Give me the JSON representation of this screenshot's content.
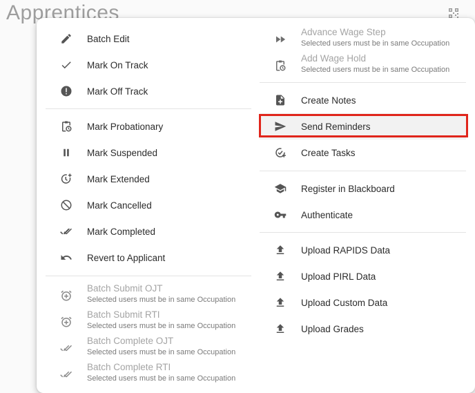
{
  "page": {
    "title": "Apprentices"
  },
  "left_menu": {
    "batch_edit": "Batch Edit",
    "mark_on_track": "Mark On Track",
    "mark_off_track": "Mark Off Track",
    "mark_probationary": "Mark Probationary",
    "mark_suspended": "Mark Suspended",
    "mark_extended": "Mark Extended",
    "mark_cancelled": "Mark Cancelled",
    "mark_completed": "Mark Completed",
    "revert_to_applicant": "Revert to Applicant",
    "batch_submit_ojt": "Batch Submit OJT",
    "batch_submit_rti": "Batch Submit RTI",
    "batch_complete_ojt": "Batch Complete OJT",
    "batch_complete_rti": "Batch Complete RTI",
    "same_occupation_note": "Selected users must be in same Occupation"
  },
  "right_menu": {
    "advance_wage_step": "Advance Wage Step",
    "add_wage_hold": "Add Wage Hold",
    "same_occupation_note": "Selected users must be in same Occupation",
    "create_notes": "Create Notes",
    "send_reminders": "Send Reminders",
    "create_tasks": "Create Tasks",
    "register_in_blackboard": "Register in Blackboard",
    "authenticate": "Authenticate",
    "upload_rapids_data": "Upload RAPIDS Data",
    "upload_pirl_data": "Upload PIRL Data",
    "upload_custom_data": "Upload Custom Data",
    "upload_grades": "Upload Grades"
  },
  "icons": {
    "enabled_color": "#555555",
    "disabled_color": "#8a8a8a",
    "highlight_color": "#e0251b"
  }
}
